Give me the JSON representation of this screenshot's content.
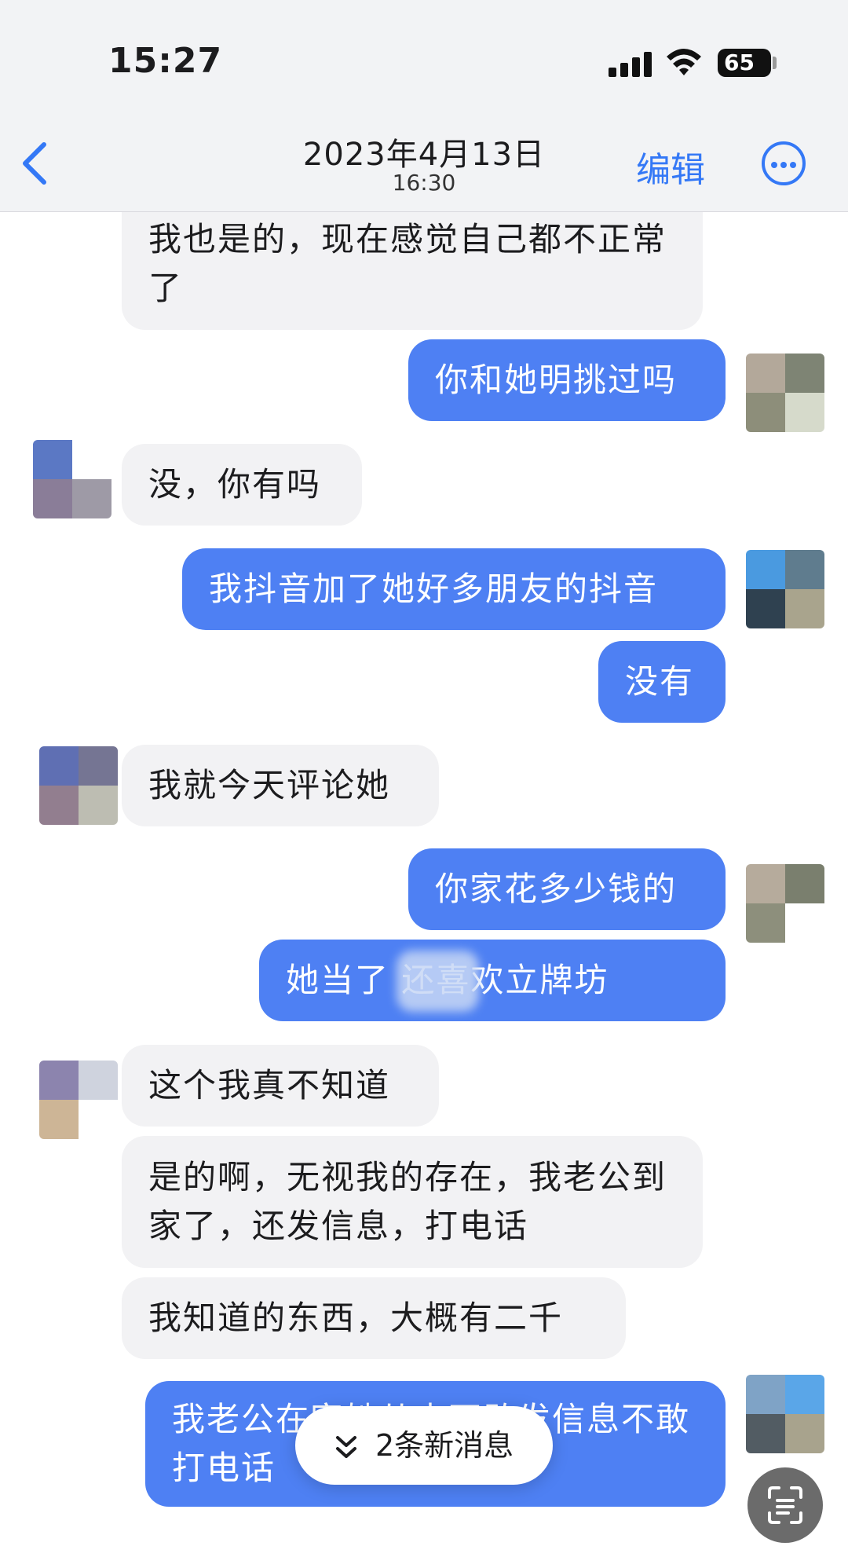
{
  "status_bar": {
    "time": "15:27",
    "battery": "65"
  },
  "header": {
    "date": "2023年4月13日",
    "time": "16:30",
    "edit_label": "编辑"
  },
  "messages": [
    {
      "side": "in",
      "text": "我也是的，现在感觉自己都不正常了"
    },
    {
      "side": "out",
      "text": "你和她明挑过吗"
    },
    {
      "side": "in",
      "text": "没，你有吗"
    },
    {
      "side": "out",
      "text": "我抖音加了她好多朋友的抖音"
    },
    {
      "side": "out",
      "text": "没有"
    },
    {
      "side": "in",
      "text": "我就今天评论她"
    },
    {
      "side": "out",
      "text": "你家花多少钱的"
    },
    {
      "side": "out",
      "text": "她当了 还喜欢立牌坊"
    },
    {
      "side": "in",
      "text": "这个我真不知道"
    },
    {
      "side": "in",
      "text": "是的啊，无视我的存在，我老公到家了，还发信息，打电话"
    },
    {
      "side": "in",
      "text": "我知道的东西，大概有二千"
    },
    {
      "side": "out",
      "text": "我老公在家她从来不敢发信息不敢打电话"
    }
  ],
  "new_messages_label": "2条新消息",
  "colors": {
    "accent": "#3478f6",
    "outgoing_bubble": "#4e80f3",
    "incoming_bubble": "#f2f2f4"
  }
}
